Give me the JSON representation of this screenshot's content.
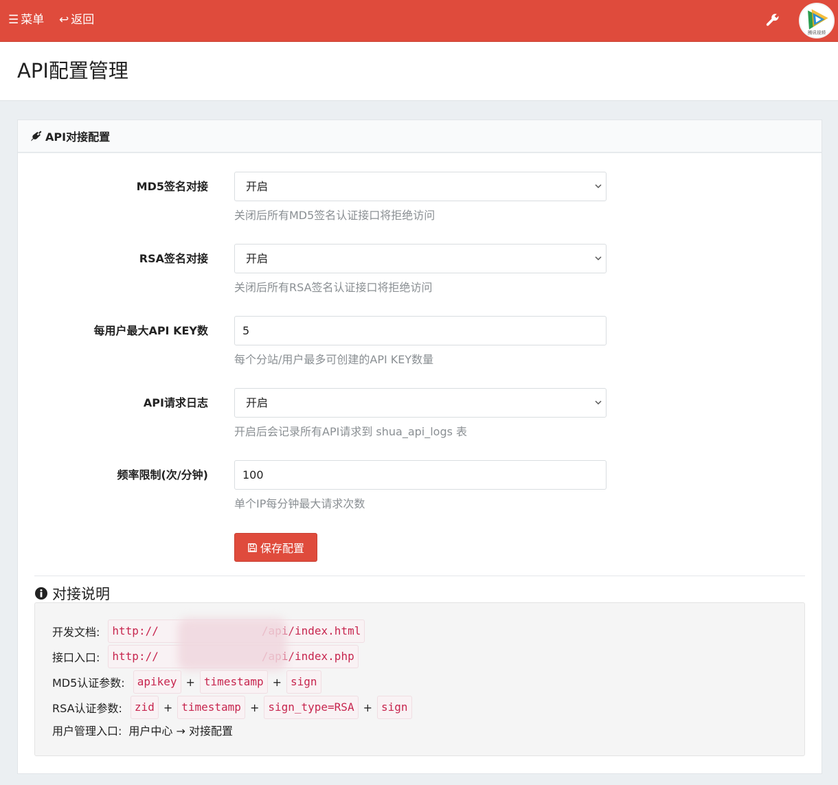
{
  "topbar": {
    "menu_label": "菜单",
    "back_label": "返回",
    "avatar_text": "腾讯视频"
  },
  "page": {
    "title": "API配置管理"
  },
  "card": {
    "title": "API对接配置",
    "fields": [
      {
        "label": "MD5签名对接",
        "value": "开启",
        "help": "关闭后所有MD5签名认证接口将拒绝访问"
      },
      {
        "label": "RSA签名对接",
        "value": "开启",
        "help": "关闭后所有RSA签名认证接口将拒绝访问"
      },
      {
        "label": "每用户最大API KEY数",
        "value": "5",
        "help": "每个分站/用户最多可创建的API KEY数量"
      },
      {
        "label": "API请求日志",
        "value": "开启",
        "help": "开启后会记录所有API请求到 shua_api_logs 表"
      },
      {
        "label": "频率限制(次/分钟)",
        "value": "100",
        "help": "单个IP每分钟最大请求次数"
      }
    ],
    "save_label": "保存配置"
  },
  "info": {
    "title": "对接说明",
    "doc_label": "开发文档:",
    "doc_url_prefix": "http://",
    "doc_url_suffix": "/api/index.html",
    "entry_label": "接口入口:",
    "entry_url_prefix": "http://",
    "entry_url_suffix": "/api/index.php",
    "md5_label": "MD5认证参数:",
    "md5_params": [
      "apikey",
      "timestamp",
      "sign"
    ],
    "rsa_label": "RSA认证参数:",
    "rsa_params": [
      "zid",
      "timestamp",
      "sign_type=RSA",
      "sign"
    ],
    "plus": "+",
    "user_label": "用户管理入口:",
    "user_path": "用户中心 → 对接配置"
  },
  "colors": {
    "primary": "#df4b3c",
    "code_text": "#c7254e",
    "code_bg": "#f9f2f4",
    "help_text": "#8a8f93"
  }
}
